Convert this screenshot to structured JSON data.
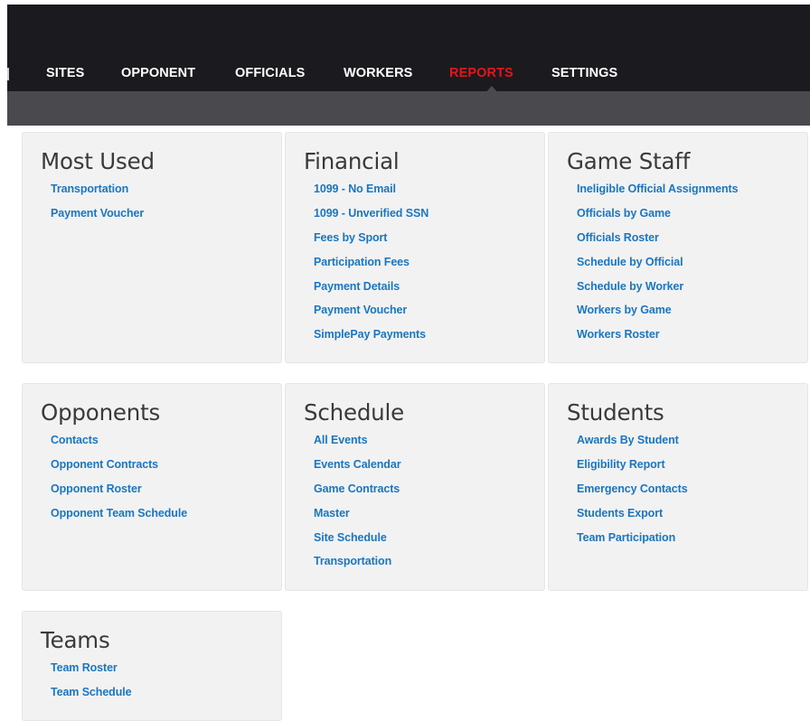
{
  "nav": {
    "items": [
      {
        "label": "SITES"
      },
      {
        "label": "OPPONENT"
      },
      {
        "label": "OFFICIALS"
      },
      {
        "label": "WORKERS"
      },
      {
        "label": "REPORTS",
        "active": true
      },
      {
        "label": "SETTINGS"
      }
    ]
  },
  "panels": [
    {
      "title": "Most Used",
      "links": [
        "Transportation",
        "Payment Voucher"
      ]
    },
    {
      "title": "Financial",
      "links": [
        "1099 - No Email",
        "1099 - Unverified SSN",
        "Fees by Sport",
        "Participation Fees",
        "Payment Details",
        "Payment Voucher",
        "SimplePay Payments"
      ]
    },
    {
      "title": "Game Staff",
      "links": [
        "Ineligible Official Assignments",
        "Officials by Game",
        "Officials Roster",
        "Schedule by Official",
        "Schedule by Worker",
        "Workers by Game",
        "Workers Roster"
      ]
    },
    {
      "title": "Opponents",
      "links": [
        "Contacts",
        "Opponent Contracts",
        "Opponent Roster",
        "Opponent Team Schedule"
      ]
    },
    {
      "title": "Schedule",
      "links": [
        "All Events",
        "Events Calendar",
        "Game Contracts",
        "Master",
        "Site Schedule",
        "Transportation"
      ]
    },
    {
      "title": "Students",
      "links": [
        "Awards By Student",
        "Eligibility Report",
        "Emergency Contacts",
        "Students Export",
        "Team Participation"
      ]
    },
    {
      "title": "Teams",
      "links": [
        "Team Roster",
        "Team Schedule"
      ]
    }
  ],
  "colors": {
    "nav_bg": "#1b1b1f",
    "subbar_bg": "#4a4a4e",
    "active": "#e3161b",
    "link": "#1a76c2",
    "panel_bg": "#f2f2f3"
  }
}
